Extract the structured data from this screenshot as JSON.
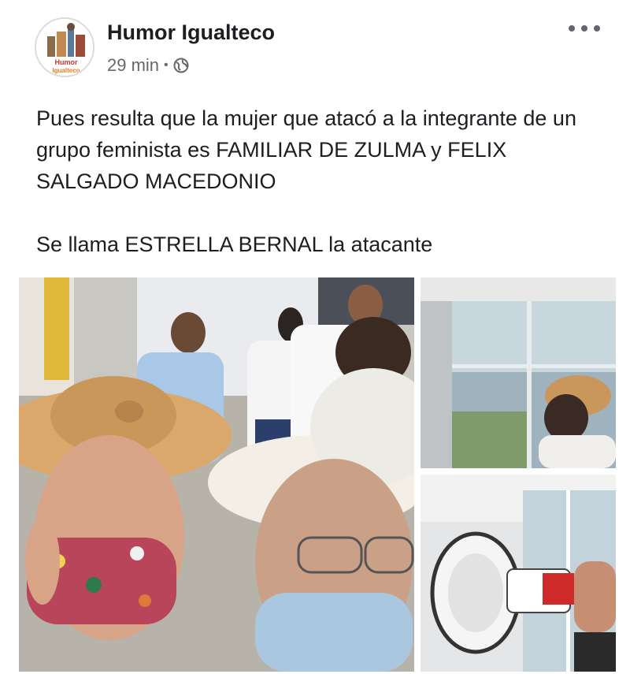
{
  "post": {
    "page_name": "Humor Igualteco",
    "avatar_text_line1": "Humor",
    "avatar_text_line2": "Igualteco",
    "time": "29 min",
    "separator": "•",
    "privacy_icon": "globe-icon",
    "more_icon": "more-options-icon",
    "text_paragraph_1": "Pues resulta que la mujer que atacó a la integrante de un grupo feminista es FAMILIAR DE ZULMA y FELIX SALGADO MACEDONIO",
    "text_paragraph_2": "Se llama ESTRELLA BERNAL la atacante"
  },
  "media": {
    "photos": [
      {
        "name": "photo-selfie-group"
      },
      {
        "name": "photo-woman-hat-window"
      },
      {
        "name": "photo-megaphone"
      }
    ]
  },
  "colors": {
    "text": "#1c1e21",
    "secondary_text": "#65676b",
    "background": "#ffffff"
  }
}
